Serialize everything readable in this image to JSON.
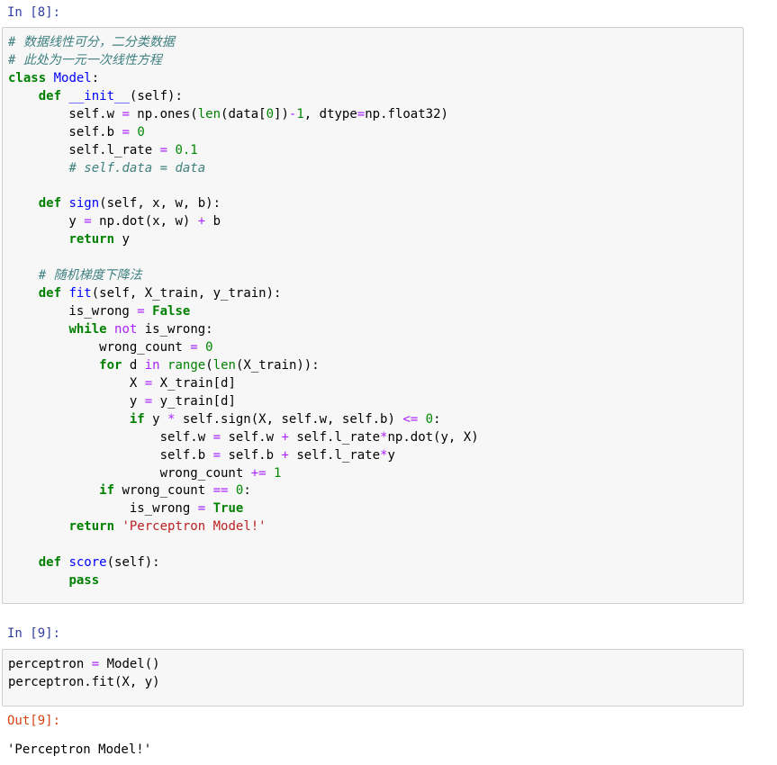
{
  "cells": [
    {
      "prompt": "In [8]:",
      "lines": [
        [
          {
            "t": "# 数据线性可分，二分类数据",
            "c": "t-com"
          }
        ],
        [
          {
            "t": "# 此处为一元一次线性方程",
            "c": "t-com"
          }
        ],
        [
          {
            "t": "class",
            "c": "t-kw-bold"
          },
          {
            "t": " "
          },
          {
            "t": "Model",
            "c": "t-cls"
          },
          {
            "t": ":"
          }
        ],
        [
          {
            "t": "    "
          },
          {
            "t": "def",
            "c": "t-kw-bold"
          },
          {
            "t": " "
          },
          {
            "t": "__init__",
            "c": "t-def"
          },
          {
            "t": "(self):"
          }
        ],
        [
          {
            "t": "        self.w "
          },
          {
            "t": "=",
            "c": "t-op"
          },
          {
            "t": " np.ones("
          },
          {
            "t": "len",
            "c": "t-bi"
          },
          {
            "t": "(data["
          },
          {
            "t": "0",
            "c": "t-num"
          },
          {
            "t": "])"
          },
          {
            "t": "-",
            "c": "t-op"
          },
          {
            "t": "1",
            "c": "t-num"
          },
          {
            "t": ", dtype"
          },
          {
            "t": "=",
            "c": "t-op"
          },
          {
            "t": "np.float32)"
          }
        ],
        [
          {
            "t": "        self.b "
          },
          {
            "t": "=",
            "c": "t-op"
          },
          {
            "t": " "
          },
          {
            "t": "0",
            "c": "t-num"
          }
        ],
        [
          {
            "t": "        self.l_rate "
          },
          {
            "t": "=",
            "c": "t-op"
          },
          {
            "t": " "
          },
          {
            "t": "0.1",
            "c": "t-num"
          }
        ],
        [
          {
            "t": "        "
          },
          {
            "t": "# self.data = data",
            "c": "t-com"
          }
        ],
        [
          {
            "t": ""
          }
        ],
        [
          {
            "t": "    "
          },
          {
            "t": "def",
            "c": "t-kw-bold"
          },
          {
            "t": " "
          },
          {
            "t": "sign",
            "c": "t-def"
          },
          {
            "t": "(self, x, w, b):"
          }
        ],
        [
          {
            "t": "        y "
          },
          {
            "t": "=",
            "c": "t-op"
          },
          {
            "t": " np.dot(x, w) "
          },
          {
            "t": "+",
            "c": "t-op"
          },
          {
            "t": " b"
          }
        ],
        [
          {
            "t": "        "
          },
          {
            "t": "return",
            "c": "t-kw-bold"
          },
          {
            "t": " y"
          }
        ],
        [
          {
            "t": ""
          }
        ],
        [
          {
            "t": "    "
          },
          {
            "t": "# 随机梯度下降法",
            "c": "t-com"
          }
        ],
        [
          {
            "t": "    "
          },
          {
            "t": "def",
            "c": "t-kw-bold"
          },
          {
            "t": " "
          },
          {
            "t": "fit",
            "c": "t-def"
          },
          {
            "t": "(self, X_train, y_train):"
          }
        ],
        [
          {
            "t": "        is_wrong "
          },
          {
            "t": "=",
            "c": "t-op"
          },
          {
            "t": " "
          },
          {
            "t": "False",
            "c": "t-kw-bold"
          }
        ],
        [
          {
            "t": "        "
          },
          {
            "t": "while",
            "c": "t-kw-bold"
          },
          {
            "t": " "
          },
          {
            "t": "not",
            "c": "t-op"
          },
          {
            "t": " is_wrong:"
          }
        ],
        [
          {
            "t": "            wrong_count "
          },
          {
            "t": "=",
            "c": "t-op"
          },
          {
            "t": " "
          },
          {
            "t": "0",
            "c": "t-num"
          }
        ],
        [
          {
            "t": "            "
          },
          {
            "t": "for",
            "c": "t-kw-bold"
          },
          {
            "t": " d "
          },
          {
            "t": "in",
            "c": "t-op"
          },
          {
            "t": " "
          },
          {
            "t": "range",
            "c": "t-bi"
          },
          {
            "t": "("
          },
          {
            "t": "len",
            "c": "t-bi"
          },
          {
            "t": "(X_train)):"
          }
        ],
        [
          {
            "t": "                X "
          },
          {
            "t": "=",
            "c": "t-op"
          },
          {
            "t": " X_train[d]"
          }
        ],
        [
          {
            "t": "                y "
          },
          {
            "t": "=",
            "c": "t-op"
          },
          {
            "t": " y_train[d]"
          }
        ],
        [
          {
            "t": "                "
          },
          {
            "t": "if",
            "c": "t-kw-bold"
          },
          {
            "t": " y "
          },
          {
            "t": "*",
            "c": "t-op"
          },
          {
            "t": " self.sign(X, self.w, self.b) "
          },
          {
            "t": "<=",
            "c": "t-op"
          },
          {
            "t": " "
          },
          {
            "t": "0",
            "c": "t-num"
          },
          {
            "t": ":"
          }
        ],
        [
          {
            "t": "                    self.w "
          },
          {
            "t": "=",
            "c": "t-op"
          },
          {
            "t": " self.w "
          },
          {
            "t": "+",
            "c": "t-op"
          },
          {
            "t": " self.l_rate"
          },
          {
            "t": "*",
            "c": "t-op"
          },
          {
            "t": "np.dot(y, X)"
          }
        ],
        [
          {
            "t": "                    self.b "
          },
          {
            "t": "=",
            "c": "t-op"
          },
          {
            "t": " self.b "
          },
          {
            "t": "+",
            "c": "t-op"
          },
          {
            "t": " self.l_rate"
          },
          {
            "t": "*",
            "c": "t-op"
          },
          {
            "t": "y"
          }
        ],
        [
          {
            "t": "                    wrong_count "
          },
          {
            "t": "+=",
            "c": "t-op"
          },
          {
            "t": " "
          },
          {
            "t": "1",
            "c": "t-num"
          }
        ],
        [
          {
            "t": "            "
          },
          {
            "t": "if",
            "c": "t-kw-bold"
          },
          {
            "t": " wrong_count "
          },
          {
            "t": "==",
            "c": "t-op"
          },
          {
            "t": " "
          },
          {
            "t": "0",
            "c": "t-num"
          },
          {
            "t": ":"
          }
        ],
        [
          {
            "t": "                is_wrong "
          },
          {
            "t": "=",
            "c": "t-op"
          },
          {
            "t": " "
          },
          {
            "t": "True",
            "c": "t-kw-bold"
          }
        ],
        [
          {
            "t": "        "
          },
          {
            "t": "return",
            "c": "t-kw-bold"
          },
          {
            "t": " "
          },
          {
            "t": "'Perceptron Model!'",
            "c": "t-str"
          }
        ],
        [
          {
            "t": ""
          }
        ],
        [
          {
            "t": "    "
          },
          {
            "t": "def",
            "c": "t-kw-bold"
          },
          {
            "t": " "
          },
          {
            "t": "score",
            "c": "t-def"
          },
          {
            "t": "(self):"
          }
        ],
        [
          {
            "t": "        "
          },
          {
            "t": "pass",
            "c": "t-kw-bold"
          }
        ]
      ]
    },
    {
      "prompt": "In [9]:",
      "lines": [
        [
          {
            "t": "perceptron "
          },
          {
            "t": "=",
            "c": "t-op"
          },
          {
            "t": " Model()"
          }
        ],
        [
          {
            "t": "perceptron.fit(X, y)"
          }
        ]
      ]
    }
  ],
  "output": {
    "prompt": "Out[9]:",
    "text": "'Perceptron Model!'"
  }
}
